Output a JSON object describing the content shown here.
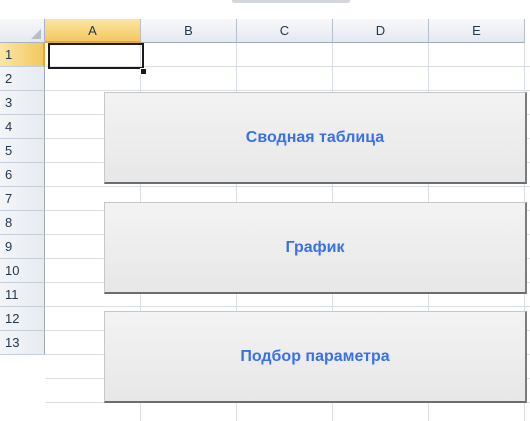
{
  "columns": [
    "A",
    "B",
    "C",
    "D",
    "E"
  ],
  "active_column": "A",
  "rows": [
    "1",
    "2",
    "3",
    "4",
    "5",
    "6",
    "7",
    "8",
    "9",
    "10",
    "11",
    "12",
    "13"
  ],
  "active_row": "1",
  "active_cell": "A1",
  "buttons": [
    {
      "label": "Сводная таблица"
    },
    {
      "label": "График"
    },
    {
      "label": "Подбор параметра"
    }
  ],
  "colors": {
    "button_text": "#3a70e8",
    "active_header": "#f3c85f",
    "grid_line": "#dadfe6"
  }
}
